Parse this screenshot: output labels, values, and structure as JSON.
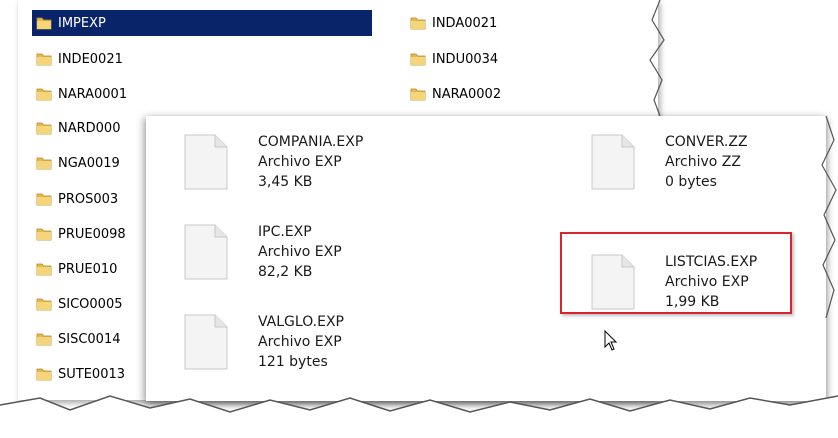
{
  "folders": {
    "left": [
      {
        "name": "IMPEXP",
        "selected": true
      },
      {
        "name": "INDE0021"
      },
      {
        "name": "NARA0001"
      },
      {
        "name": "NARD000"
      },
      {
        "name": "NGA0019"
      },
      {
        "name": "PROS003"
      },
      {
        "name": "PRUE0098"
      },
      {
        "name": "PRUE010"
      },
      {
        "name": "SICO0005"
      },
      {
        "name": "SISC0014"
      },
      {
        "name": "SUTE0013"
      }
    ],
    "right": [
      {
        "name": "INDA0021"
      },
      {
        "name": "INDU0034"
      },
      {
        "name": "NARA0002"
      }
    ]
  },
  "files": [
    {
      "name": "COMPANIA.EXP",
      "type": "Archivo EXP",
      "size": "3,45 KB"
    },
    {
      "name": "CONVER.ZZ",
      "type": "Archivo ZZ",
      "size": "0 bytes"
    },
    {
      "name": "IPC.EXP",
      "type": "Archivo EXP",
      "size": "82,2 KB"
    },
    {
      "name": "LISTCIAS.EXP",
      "type": "Archivo EXP",
      "size": "1,99 KB",
      "highlighted": true
    },
    {
      "name": "VALGLO.EXP",
      "type": "Archivo EXP",
      "size": "121 bytes"
    }
  ],
  "colors": {
    "selection": "#0a246a",
    "highlight": "#d9232d",
    "folder": "#e8b84a"
  },
  "icons": {
    "folder": "folder-icon",
    "file": "file-icon",
    "cursor": "mouse-pointer-icon"
  }
}
